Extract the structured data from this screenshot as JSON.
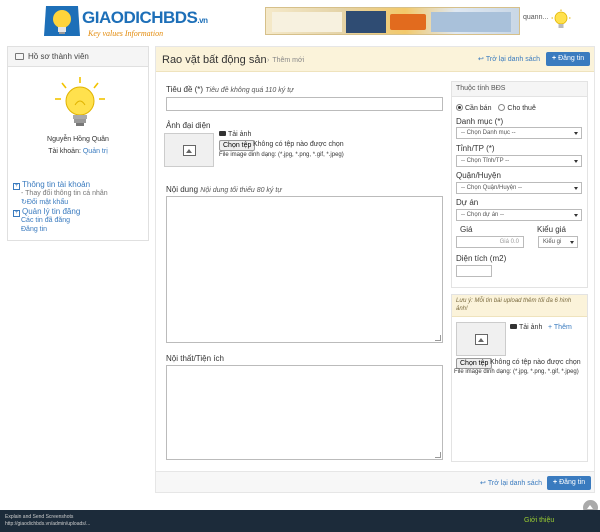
{
  "header": {
    "logo_text": "GIAODICH",
    "logo_bds": "BDS",
    "logo_vn": ".vn",
    "logo_tagline": "Key   values   Information",
    "user_label": "quann..."
  },
  "profile": {
    "heading": "Hồ sơ thành viên",
    "name": "Nguyễn Hồng Quân",
    "account_label": "Tài khoản:",
    "account_role": "Quản trị"
  },
  "left_menu": {
    "account_group": "Thông tin tài khoản",
    "account_items": [
      "- Thay đổi thông tin cá nhân",
      "Đổi mật khẩu"
    ],
    "post_group": "Quản lý tin đăng",
    "post_items": [
      "Các tin đã đăng",
      "Đăng tin"
    ]
  },
  "main": {
    "title": "Rao vặt bất động sản",
    "breadcrumb_sep": "›",
    "breadcrumb": "Thêm mới",
    "back_label": "Trở lại danh sách",
    "post_label": "Đăng tin",
    "title_label": "Tiêu đề (*)",
    "title_hint": "Tiêu đề không quá 110 ký tự",
    "image_label": "Ảnh đại diện",
    "upload_label": "Tải ảnh",
    "file_button": "Chọn tệp",
    "file_none": "Không có tệp nào được chọn",
    "file_hint": "File image dinh dạng: (*.jpg, *.png, *.gif, *.jpeg)",
    "content_label": "Nội dung",
    "content_hint": "Nội dung tối thiểu 80 ký tự",
    "interior_label": "Nội thất/Tiện ích"
  },
  "properties": {
    "heading": "Thuộc tính BĐS",
    "radio_sell": "Cần bán",
    "radio_rent": "Cho thuê",
    "category_label": "Danh mục (*)",
    "category_value": "-- Chọn Danh mục --",
    "city_label": "Tỉnh/TP (*)",
    "city_value": "-- Chọn Tỉnh/TP --",
    "district_label": "Quận/Huyện",
    "district_value": "-- Chọn Quận/Huyện --",
    "project_label": "Dự án",
    "project_value": "-- Chọn dự án --",
    "price_label": "Giá",
    "price_placeholder": "Giá 0.0",
    "price_type_label": "Kiểu giá",
    "price_type_value": "Kiểu gi",
    "area_label": "Diện tích (m2)"
  },
  "uploads": {
    "note": "Lưu ý: Mỗi tin bài upload thêm tối đa 6 hình ảnh!",
    "upload_label": "Tải ảnh",
    "add_label": "+ Thêm",
    "file_button": "Chọn tệp",
    "file_none": "Không có tệp nào được chọn",
    "file_hint": "File image dinh dạng: (*.jpg, *.png, *.gif, *.jpeg)"
  },
  "footer": {
    "line1": "Explain and Send Screenshots",
    "line2": "http://giaodichbds.vn/admin/uploads/...",
    "link": "Giới thiệu"
  },
  "colors": {
    "accent": "#3a7bbf",
    "header_bg": "#fbf3da",
    "footer_bg": "#1c2b3a",
    "footer_link": "#9acd32"
  }
}
